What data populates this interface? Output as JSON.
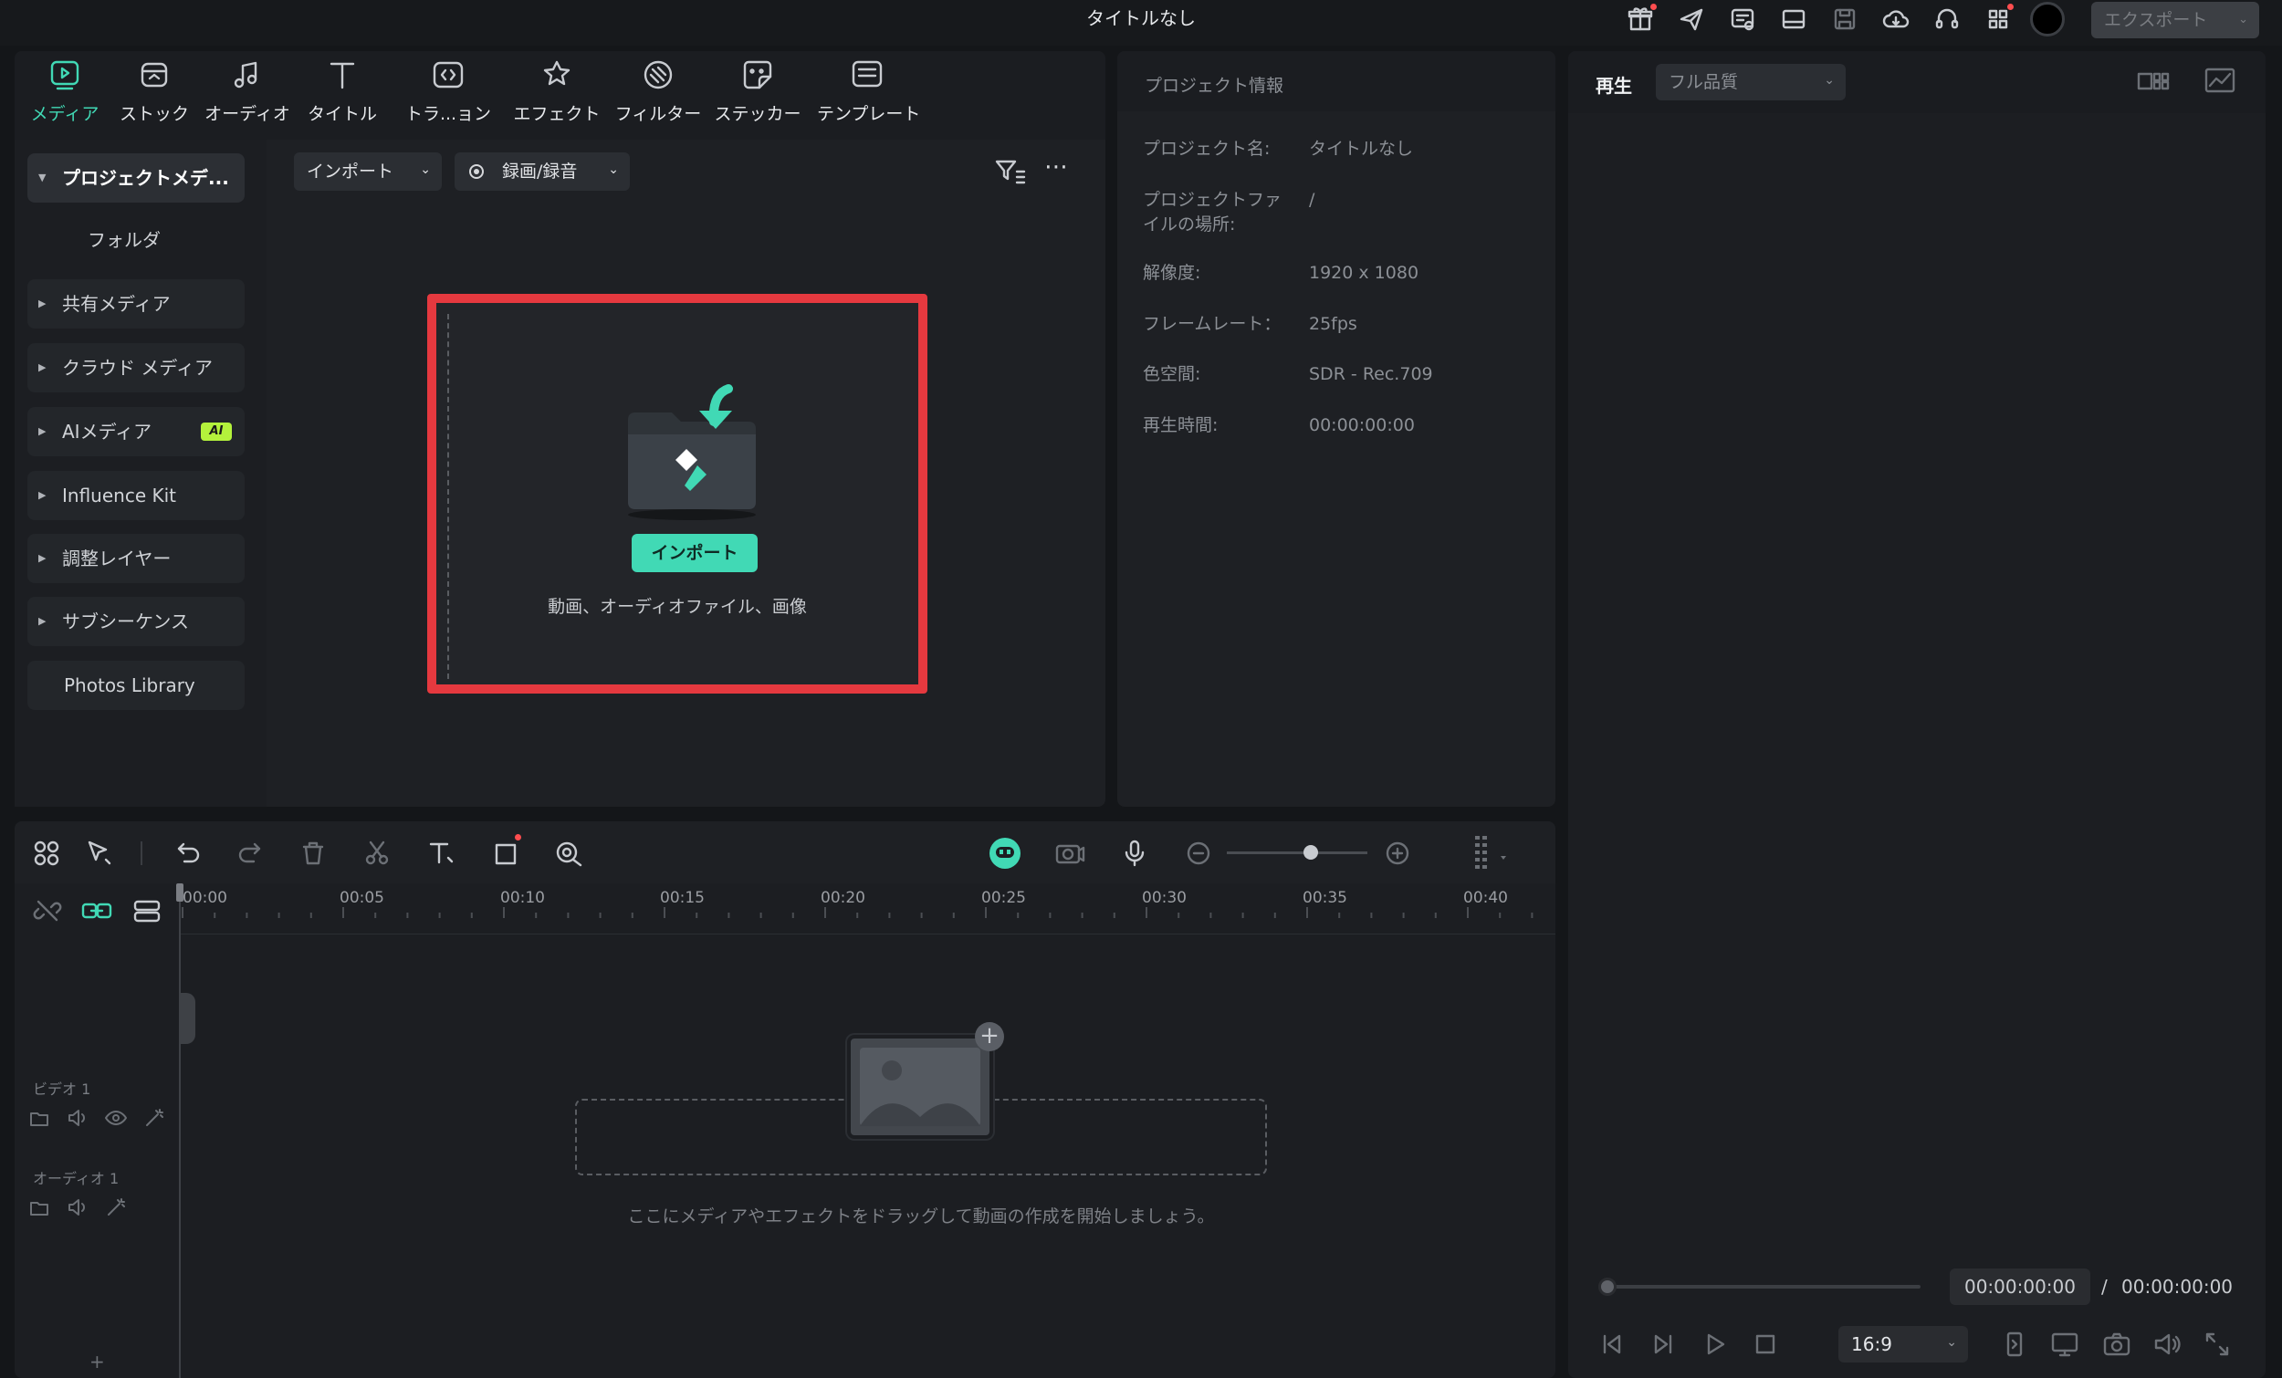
{
  "window": {
    "title": "タイトルなし"
  },
  "titlebar": {
    "export_label": "エクスポート"
  },
  "media_toolbar": {
    "tools": [
      {
        "label": "メディア",
        "icon": "media-icon",
        "active": true
      },
      {
        "label": "ストック",
        "icon": "stock-icon"
      },
      {
        "label": "オーディオ",
        "icon": "music-note-icon"
      },
      {
        "label": "タイトル",
        "icon": "title-t-icon"
      },
      {
        "label": "トラ...ョン",
        "icon": "transition-icon"
      },
      {
        "label": "エフェクト",
        "icon": "effects-icon"
      },
      {
        "label": "フィルター",
        "icon": "filter-icon"
      },
      {
        "label": "ステッカー",
        "icon": "sticker-icon"
      },
      {
        "label": "テンプレート",
        "icon": "template-icon"
      }
    ]
  },
  "sidebar": {
    "items": [
      {
        "label": "プロジェクトメデ..."
      },
      {
        "label": "フォルダ"
      },
      {
        "label": "共有メディア"
      },
      {
        "label": "クラウド メディア"
      },
      {
        "label": "AIメディア",
        "badge": "AI"
      },
      {
        "label": "Influence Kit"
      },
      {
        "label": "調整レイヤー"
      },
      {
        "label": "サブシーケンス"
      },
      {
        "label": "Photos Library"
      }
    ]
  },
  "media_area": {
    "import_dropdown": "インポート",
    "record_dropdown": "録画/録音",
    "import_button": "インポート",
    "hint": "動画、オーディオファイル、画像",
    "highlight_color": "#e5393f",
    "accent_color": "#41d9b5"
  },
  "project_info": {
    "title": "プロジェクト情報",
    "rows": [
      {
        "label": "プロジェクト名:",
        "value": "タイトルなし"
      },
      {
        "label": "プロジェクトファ",
        "label2": "イルの場所:",
        "value": "/"
      },
      {
        "label": "解像度:",
        "value": "1920 x 1080"
      },
      {
        "label": "フレームレート：",
        "value": "25fps"
      },
      {
        "label": "色空間:",
        "value": "SDR - Rec.709"
      },
      {
        "label": "再生時間:",
        "value": "00:00:00:00"
      }
    ]
  },
  "preview": {
    "tab": "再生",
    "quality": "フル品質",
    "current_time": "00:00:00:00",
    "separator": "/",
    "total_time": "00:00:00:00",
    "aspect": "16:9"
  },
  "timeline": {
    "ticks": [
      "00:00",
      "00:05",
      "00:10",
      "00:15",
      "00:20",
      "00:25",
      "00:30",
      "00:35",
      "00:40"
    ],
    "tracks": [
      {
        "label": "ビデオ 1"
      },
      {
        "label": "オーディオ 1"
      }
    ],
    "drop_hint": "ここにメディアやエフェクトをドラッグして動画の作成を開始しましょう。",
    "add_track": "+"
  }
}
